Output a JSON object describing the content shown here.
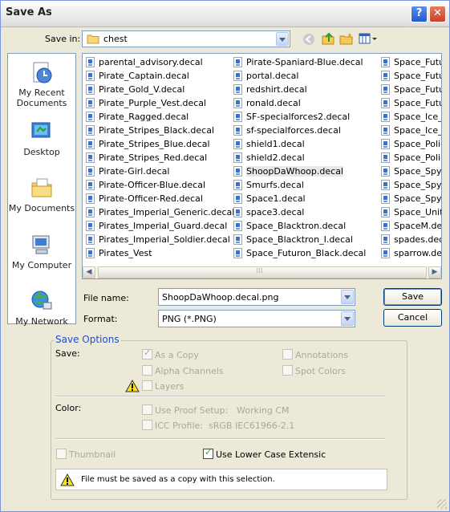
{
  "window": {
    "title": "Save As",
    "help_glyph": "?",
    "close_glyph": "✕"
  },
  "top": {
    "save_in_label": "Save in:",
    "folder": "chest"
  },
  "places": [
    {
      "label": "My Recent\nDocuments",
      "icon": "recent-documents-icon"
    },
    {
      "label": "Desktop",
      "icon": "desktop-icon"
    },
    {
      "label": "My Documents",
      "icon": "my-documents-icon"
    },
    {
      "label": "My Computer",
      "icon": "my-computer-icon"
    },
    {
      "label": "My Network",
      "icon": "my-network-icon"
    }
  ],
  "files": {
    "col1": [
      "parental_advisory.decal",
      "Pirate_Captain.decal",
      "Pirate_Gold_V.decal",
      "Pirate_Purple_Vest.decal",
      "Pirate_Ragged.decal",
      "Pirate_Stripes_Black.decal",
      "Pirate_Stripes_Blue.decal",
      "Pirate_Stripes_Red.decal",
      "Pirate-Girl.decal",
      "Pirate-Officer-Blue.decal",
      "Pirate-Officer-Red.decal",
      "Pirates_Imperial_Generic.decal",
      "Pirates_Imperial_Guard.decal",
      "Pirates_Imperial_Soldier.decal",
      "Pirates_Vest"
    ],
    "col2": [
      "Pirate-Spaniard-Blue.decal",
      "portal.decal",
      "redshirt.decal",
      "ronald.decal",
      "SF-specialforces2.decal",
      "sf-specialforces.decal",
      "shield1.decal",
      "shield2.decal",
      "ShoopDaWhoop.decal",
      "Smurfs.decal",
      "Space1.decal",
      "space3.decal",
      "Space_Blacktron.decal",
      "Space_Blacktron_I.decal",
      "Space_Futuron_Black.decal"
    ],
    "col3": [
      "Space_Futur",
      "Space_Futur",
      "Space_Futur",
      "Space_Futur",
      "Space_Ice_P",
      "Space_Ice_P",
      "Space_Police",
      "Space_Police",
      "Space_Spyri",
      "Space_Spyri",
      "Space_Spyri",
      "Space_Unitro",
      "SpaceM.deca",
      "spades.deca",
      "sparrow.dec"
    ],
    "selected": "ShoopDaWhoop.decal"
  },
  "form": {
    "filename_label": "File name:",
    "filename_value": "ShoopDaWhoop.decal.png",
    "format_label": "Format:",
    "format_value": "PNG (*.PNG)",
    "save_button": "Save",
    "cancel_button": "Cancel"
  },
  "options": {
    "group_title": "Save Options",
    "save_label": "Save:",
    "as_copy": "As a Copy",
    "alpha": "Alpha Channels",
    "layers": "Layers",
    "annotations": "Annotations",
    "spot_colors": "Spot Colors",
    "color_label": "Color:",
    "proof_setup": "Use Proof Setup:",
    "proof_value": "Working CM",
    "icc_profile": "ICC Profile:",
    "icc_value": "sRGB IEC61966-2.1",
    "thumbnail": "Thumbnail",
    "lower_case": "Use Lower Case Extensic",
    "warning": "File must be saved as a copy with this selection."
  },
  "colors": {
    "accent": "#1e4fc8",
    "window_bg": "#ece9d8",
    "border": "#7f9db9"
  }
}
